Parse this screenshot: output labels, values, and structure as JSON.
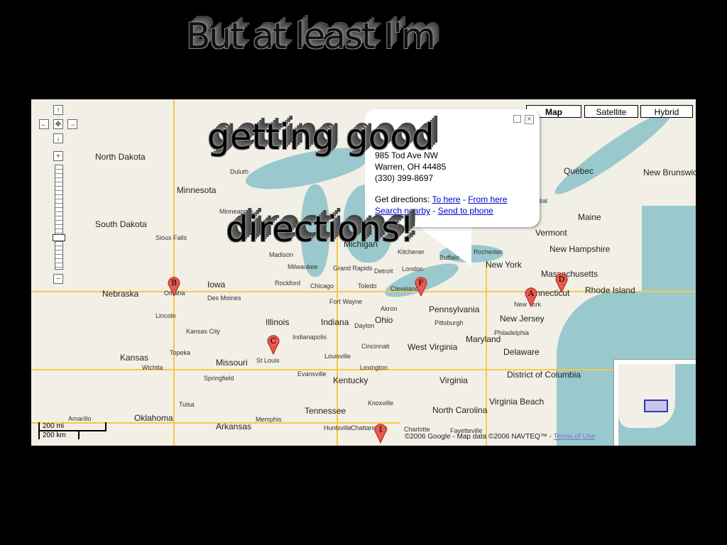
{
  "captions": {
    "line1": "But at least I'm",
    "line2": "getting good",
    "line3": "directions!"
  },
  "map": {
    "type_buttons": [
      "Map",
      "Satellite",
      "Hybrid"
    ],
    "selected_type": "Map",
    "controls": {
      "pan_up": "↑",
      "pan_left": "←",
      "pan_center": "✥",
      "pan_right": "→",
      "pan_down": "↓",
      "zoom_in": "+",
      "zoom_out": "−"
    },
    "info_window": {
      "address1": "985 Tod Ave NW",
      "address2": "Warren, OH 44485",
      "phone": "(330) 399-8697",
      "directions_label": "Get directions:",
      "to_here": "To here",
      "from_here": "From here",
      "search_nearby": "Search nearby",
      "send_to_phone": "Send to phone",
      "separator": "-"
    },
    "region_labels": [
      "North Dakota",
      "Minnesota",
      "South Dakota",
      "Nebraska",
      "Iowa",
      "Kansas",
      "Missouri",
      "Illinois",
      "Indiana",
      "Ohio",
      "Michigan",
      "Pennsylvania",
      "New York",
      "Vermont",
      "New Hampshire",
      "Maine",
      "Massachusetts",
      "Connecticut",
      "Rhode Island",
      "New Jersey",
      "Maryland",
      "Delaware",
      "District of Columbia",
      "West Virginia",
      "Virginia",
      "Kentucky",
      "Tennessee",
      "North Carolina",
      "Arkansas",
      "Oklahoma",
      "Québec",
      "New Brunswick",
      "Virginia Beach"
    ],
    "city_labels": [
      "Duluth",
      "Minneapolis",
      "Sioux Falls",
      "Omaha",
      "Lincoln",
      "Des Moines",
      "Kansas City",
      "Topeka",
      "Wichita",
      "Springfield",
      "Tulsa",
      "Amarillo",
      "St Louis",
      "Evansville",
      "Louisville",
      "Lexington",
      "Indianapolis",
      "Cincinnati",
      "Dayton",
      "Fort Wayne",
      "Toledo",
      "Detroit",
      "Cleveland",
      "Akron",
      "Pittsburgh",
      "Philadelphia",
      "New York",
      "Chicago",
      "Rockford",
      "Milwaukee",
      "Madison",
      "Grand Rapids",
      "London",
      "Kitchener",
      "Buffalo",
      "Rochester",
      "Knoxville",
      "Memphis",
      "Huntsville",
      "Chattanooga",
      "Charlotte",
      "Fayetteville",
      "réal"
    ],
    "markers": [
      "A",
      "B",
      "C",
      "D",
      "F",
      "I"
    ],
    "marker_color": "#e85a4f",
    "scale": {
      "miles": "200 mi",
      "km": "200 km"
    },
    "copyright": "©2006 Google - Map data ©2006 NAVTEQ™ -",
    "terms": "Terms of Use"
  }
}
